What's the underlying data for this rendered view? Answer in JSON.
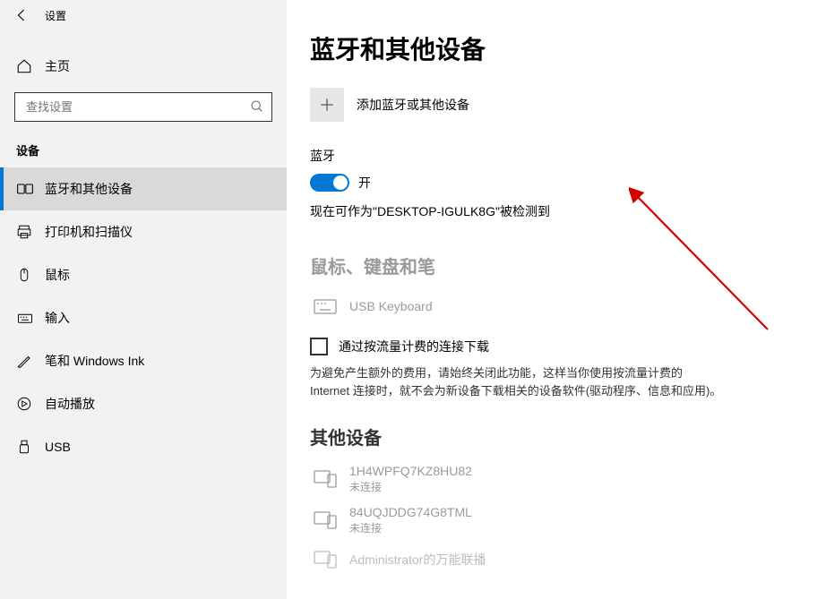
{
  "titlebar": {
    "title": "设置"
  },
  "home": {
    "label": "主页"
  },
  "search": {
    "placeholder": "查找设置"
  },
  "category": {
    "label": "设备"
  },
  "nav": [
    {
      "label": "蓝牙和其他设备",
      "icon": "bluetooth-devices"
    },
    {
      "label": "打印机和扫描仪",
      "icon": "printer"
    },
    {
      "label": "鼠标",
      "icon": "mouse"
    },
    {
      "label": "输入",
      "icon": "keyboard"
    },
    {
      "label": "笔和 Windows Ink",
      "icon": "pen"
    },
    {
      "label": "自动播放",
      "icon": "autoplay"
    },
    {
      "label": "USB",
      "icon": "usb"
    }
  ],
  "page": {
    "title": "蓝牙和其他设备",
    "add_label": "添加蓝牙或其他设备",
    "bt_section_label": "蓝牙",
    "toggle_state": "开",
    "discover_text": "现在可作为\"DESKTOP-IGULK8G\"被检测到",
    "group_input": "鼠标、键盘和笔",
    "usb_keyboard_name": "USB Keyboard",
    "metered_label": "通过按流量计费的连接下载",
    "metered_hint": "为避免产生额外的费用，请始终关闭此功能，这样当你使用按流量计费的 Internet 连接时，就不会为新设备下载相关的设备软件(驱动程序、信息和应用)。",
    "group_other": "其他设备",
    "dev1_name": "1H4WPFQ7KZ8HU82",
    "dev1_status": "未连接",
    "dev2_name": "84UQJDDG74G8TML",
    "dev2_status": "未连接",
    "dev3_name": "Administrator的万能联播"
  }
}
